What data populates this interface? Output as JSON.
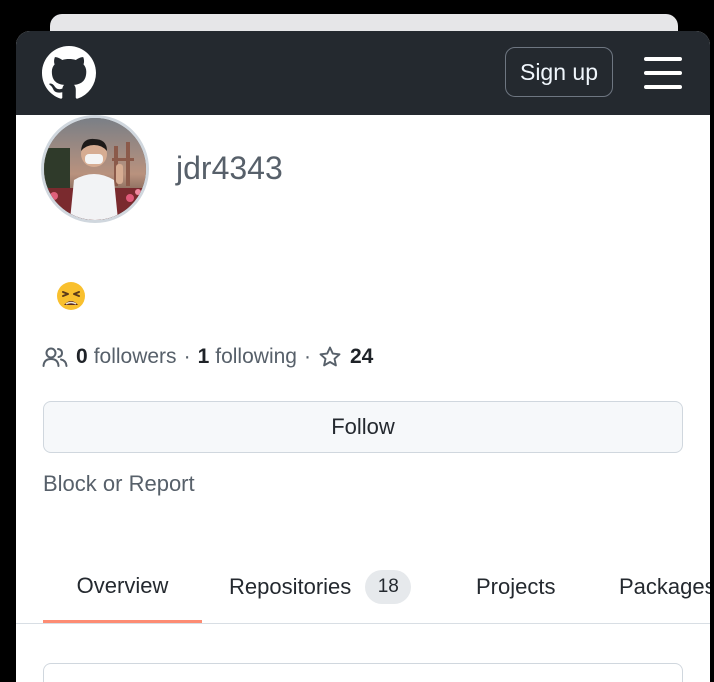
{
  "header": {
    "signup_label": "Sign up"
  },
  "profile": {
    "username": "jdr4343",
    "status_emoji": "weary-face",
    "followers_count": "0",
    "followers_label": "followers",
    "following_count": "1",
    "following_label": "following",
    "stars_count": "24",
    "separator": "·"
  },
  "actions": {
    "follow_label": "Follow",
    "block_label": "Block or Report"
  },
  "tabs": [
    {
      "label": "Overview",
      "selected": true
    },
    {
      "label": "Repositories",
      "count": "18"
    },
    {
      "label": "Projects"
    },
    {
      "label": "Packages"
    }
  ],
  "colors": {
    "header_bg": "#24292f",
    "tab_underline": "#fd8c73",
    "muted_text": "#57606a"
  }
}
